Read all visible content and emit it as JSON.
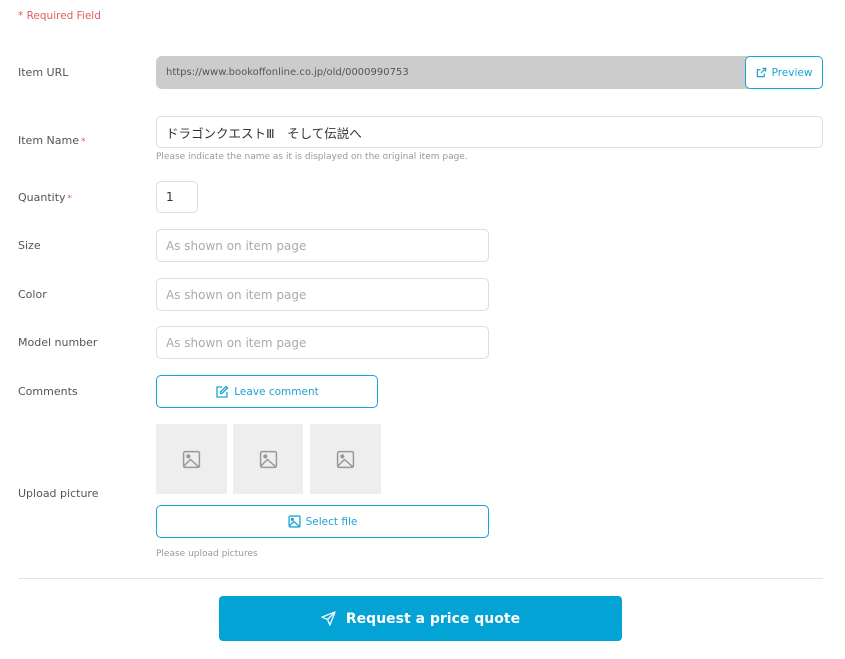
{
  "form": {
    "required_note": "* Required Field",
    "required_marker": "*",
    "item_url": {
      "label": "Item URL",
      "value": "https://www.bookoffonline.co.jp/old/0000990753",
      "preview_label": "Preview"
    },
    "item_name": {
      "label": "Item Name",
      "value": "ドラゴンクエストⅢ　そして伝説へ",
      "hint": "Please indicate the name as it is displayed on the original item page."
    },
    "quantity": {
      "label": "Quantity",
      "value": "1"
    },
    "size": {
      "label": "Size",
      "placeholder": "As shown on item page",
      "value": ""
    },
    "color": {
      "label": "Color",
      "placeholder": "As shown on item page",
      "value": ""
    },
    "model_number": {
      "label": "Model number",
      "placeholder": "As shown on item page",
      "value": ""
    },
    "comments": {
      "label": "Comments",
      "button_label": "Leave comment"
    },
    "upload": {
      "label": "Upload picture",
      "slots": [
        {
          "icon": "image-placeholder-icon"
        },
        {
          "icon": "image-placeholder-icon"
        },
        {
          "icon": "image-placeholder-icon"
        }
      ],
      "button_label": "Select file",
      "hint": "Please upload pictures"
    },
    "submit_label": "Request a price quote"
  },
  "colors": {
    "accent": "#1aa3d3",
    "primary_button": "#03a3d6",
    "required": "#e25c5c",
    "disabled_field": "#cccccc",
    "thumb_bg": "#eeeeee"
  }
}
